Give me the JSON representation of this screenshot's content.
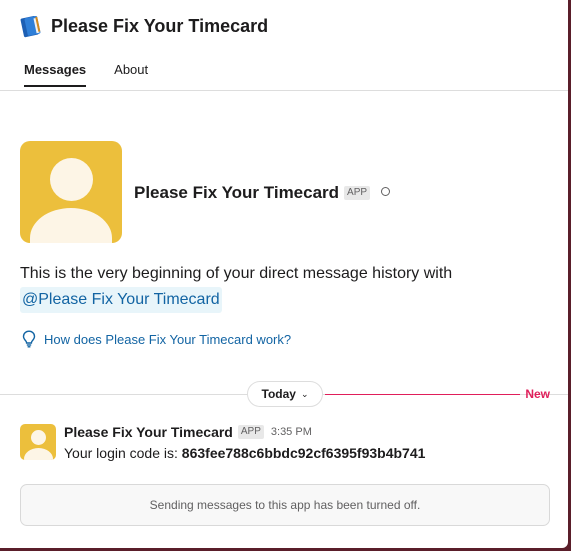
{
  "header": {
    "title": "Please Fix Your Timecard",
    "icon": "book-icon"
  },
  "tabs": [
    {
      "label": "Messages",
      "active": true
    },
    {
      "label": "About",
      "active": false
    }
  ],
  "intro": {
    "name": "Please Fix Your Timecard",
    "badge": "APP",
    "presence": "away",
    "text": "This is the very beginning of your direct message history with",
    "mention": "@Please Fix Your Timecard"
  },
  "help_link": "How does Please Fix Your Timecard work?",
  "divider": {
    "label": "Today",
    "new_label": "New"
  },
  "message": {
    "sender": "Please Fix Your Timecard",
    "badge": "APP",
    "time": "3:35 PM",
    "text_prefix": "Your login code is: ",
    "code": "863fee788c6bbdc92cf6395f93b4b741"
  },
  "composer_notice": "Sending messages to this app has been turned off.",
  "colors": {
    "avatar_bg": "#ecbf3c",
    "link": "#1264a3",
    "new_marker": "#e01e5a"
  }
}
